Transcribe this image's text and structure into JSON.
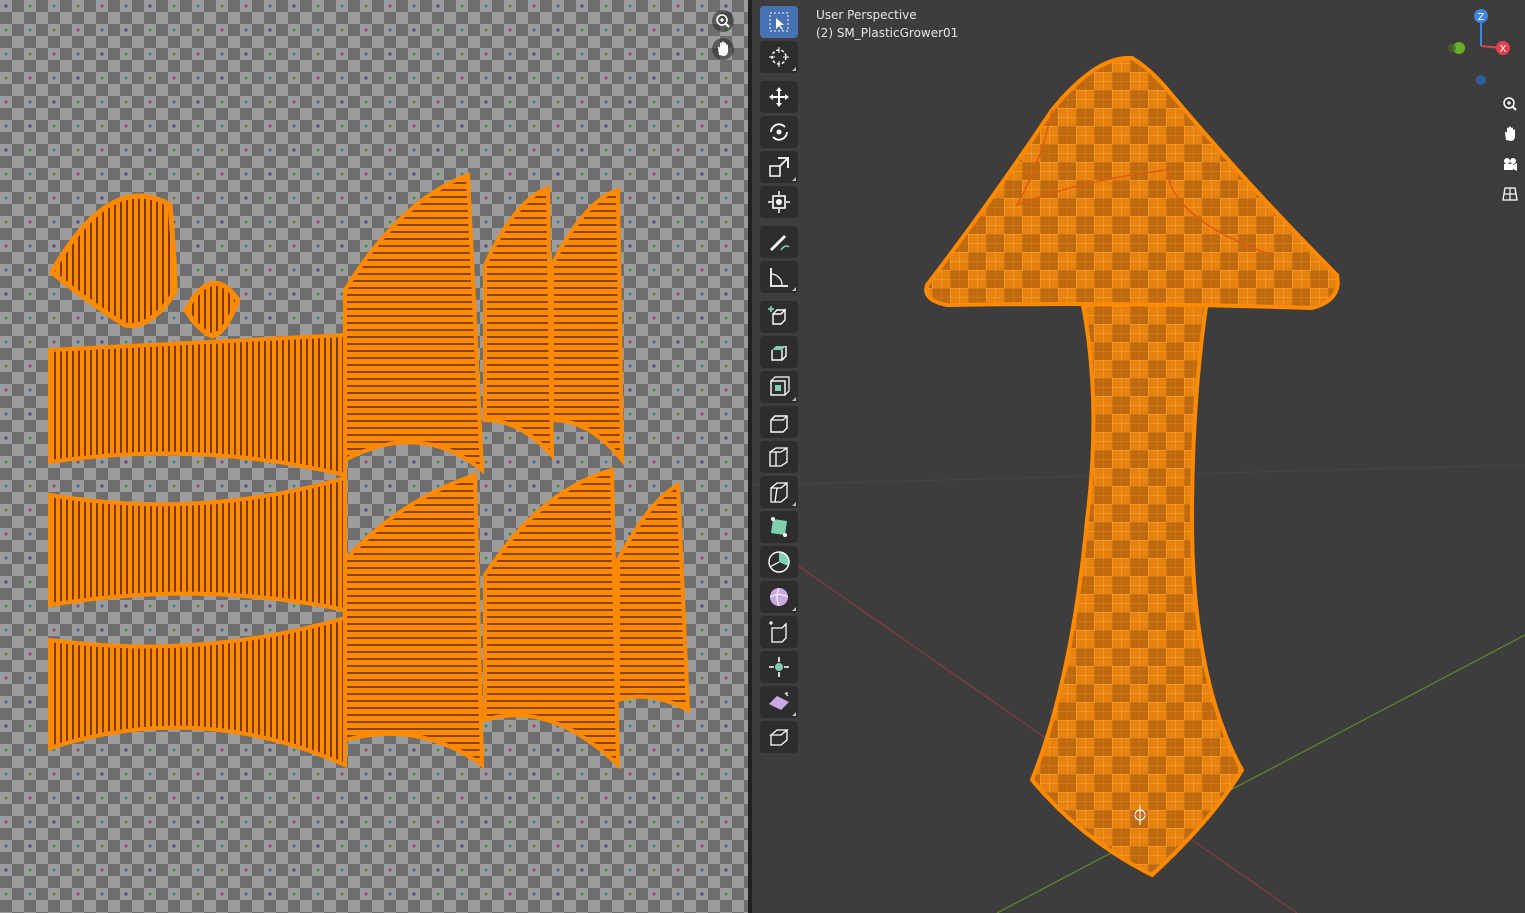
{
  "viewport": {
    "header_line1": "User Perspective",
    "header_line2": "(2) SM_PlasticGrower01"
  },
  "gizmo": {
    "z_label": "Z",
    "x_label": "X"
  },
  "toolbar": {
    "tools": [
      {
        "icon": "select-box-icon",
        "active": true
      },
      {
        "icon": "cursor-icon"
      },
      {
        "icon": "move-icon"
      },
      {
        "icon": "rotate-icon"
      },
      {
        "icon": "scale-icon"
      },
      {
        "icon": "transform-icon"
      },
      {
        "icon": "annotate-icon"
      },
      {
        "icon": "measure-icon"
      },
      {
        "icon": "add-cube-icon"
      },
      {
        "icon": "extrude-region-icon"
      },
      {
        "icon": "inset-faces-icon"
      },
      {
        "icon": "bevel-icon"
      },
      {
        "icon": "loop-cut-icon"
      },
      {
        "icon": "knife-icon"
      },
      {
        "icon": "poly-build-icon"
      },
      {
        "icon": "spin-icon"
      },
      {
        "icon": "smooth-icon"
      },
      {
        "icon": "edge-slide-icon"
      },
      {
        "icon": "shrink-fatten-icon"
      },
      {
        "icon": "shear-icon"
      },
      {
        "icon": "rip-region-icon"
      }
    ]
  },
  "colors": {
    "selection_orange": "#ff8a00",
    "viewport_bg": "#3d3d3d",
    "checker_light": "#9c9c9c",
    "checker_dark": "#6e6e6e",
    "active_tool": "#4772b3",
    "axis_x": "#e0414c",
    "axis_y": "#6aae27",
    "axis_z": "#3f85e0"
  }
}
